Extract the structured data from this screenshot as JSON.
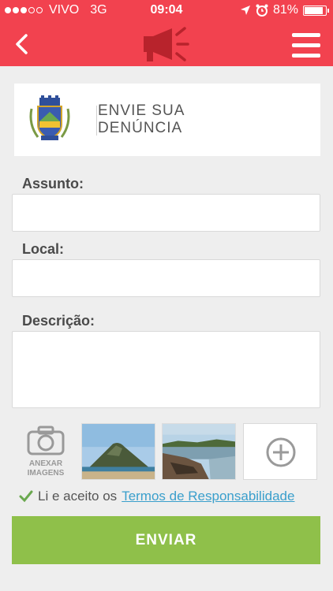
{
  "status_bar": {
    "carrier": "VIVO",
    "network": "3G",
    "time": "09:04",
    "battery": "81%",
    "battery_level": 0.81,
    "signal_bars": 3
  },
  "header": {
    "back_icon": "chevron-left-icon",
    "center_icon": "megaphone-icon",
    "menu_icon": "hamburger-menu-icon"
  },
  "card": {
    "title_line1": "ENVIE SUA",
    "title_line2": "DENÚNCIA"
  },
  "form": {
    "subject_label": "Assunto:",
    "subject_value": "",
    "location_label": "Local:",
    "location_value": "",
    "description_label": "Descrição:",
    "description_value": ""
  },
  "attachments": {
    "camera_caption_line1": "ANEXAR",
    "camera_caption_line2": "IMAGENS",
    "add_icon": "plus-circle-icon"
  },
  "terms": {
    "prefix": "Li e aceito os",
    "link": "Termos de Responsabilidade",
    "checked": true
  },
  "submit_label": "ENVIAR",
  "colors": {
    "header": "#f2424f",
    "submit": "#8fc04a",
    "link": "#3a9fcc",
    "background": "#eeeeee"
  }
}
